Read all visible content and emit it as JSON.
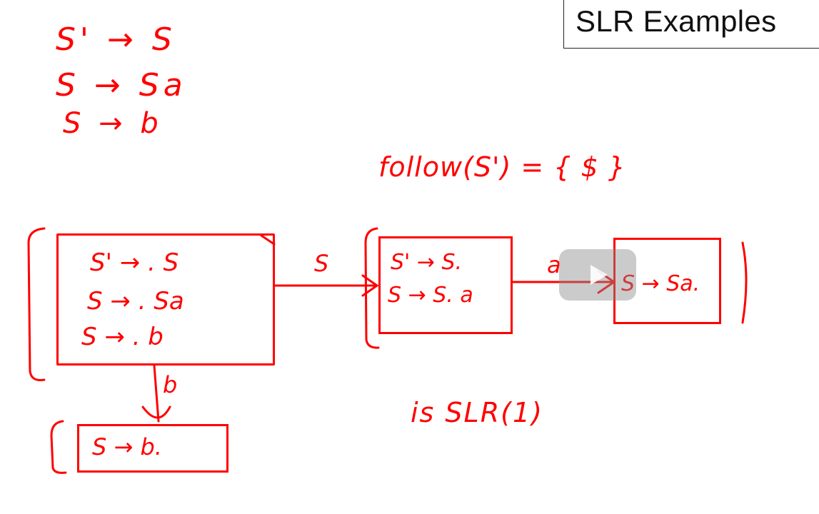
{
  "slide": {
    "title": "SLR Examples"
  },
  "grammar": {
    "rules": [
      "S' → S",
      "S → Sa",
      "S → b"
    ]
  },
  "follow_set": "follow(S') = { $ }",
  "states": [
    {
      "items": [
        "S' → . S",
        "S → . Sa",
        "S → . b"
      ]
    },
    {
      "items": [
        "S' → S.",
        "S → S. a"
      ]
    },
    {
      "items": [
        "S → Sa."
      ]
    },
    {
      "items": [
        "S → b."
      ]
    }
  ],
  "transitions": [
    {
      "label": "S"
    },
    {
      "label": "a"
    },
    {
      "label": "b"
    }
  ],
  "conclusion": "is SLR(1)",
  "colors": {
    "ink": "#ff0000",
    "title_border": "#222222",
    "overlay": "#8c8c8c"
  },
  "icons": {
    "video_overlay": "play-icon"
  }
}
